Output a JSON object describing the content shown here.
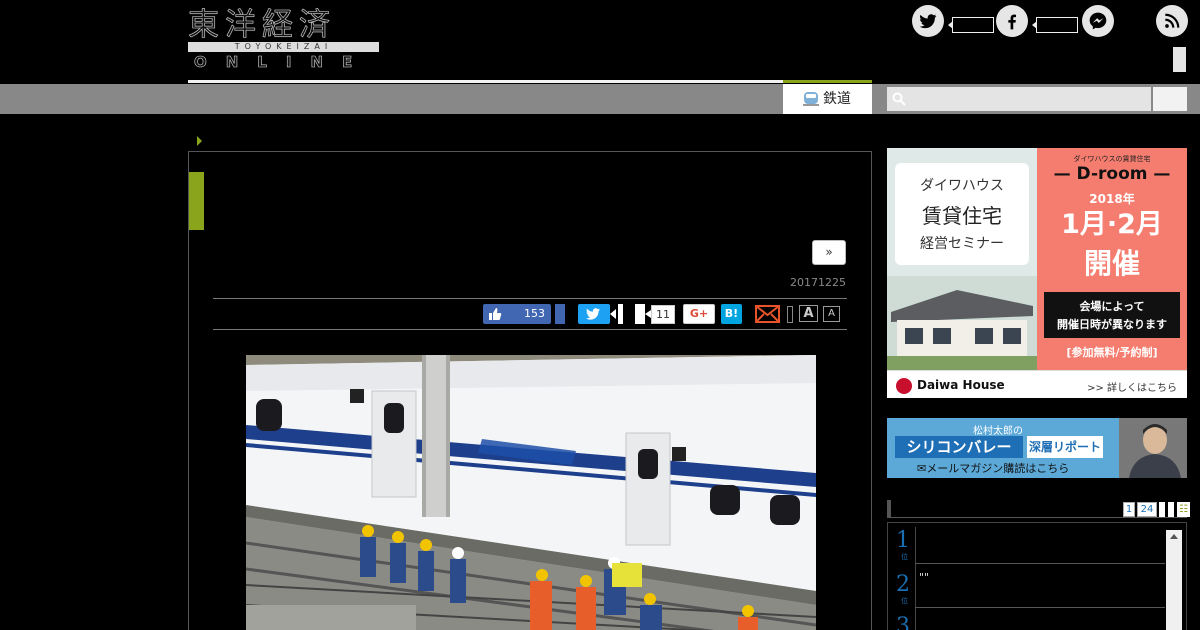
{
  "logo": {
    "kanji": "東洋経済",
    "romaji": "TOYOKEIZAI",
    "online": "ONLINE"
  },
  "nav": {
    "tab_label": "鉄道",
    "search_placeholder": ""
  },
  "article": {
    "next_label": "»",
    "date": "20171225",
    "share": {
      "like_count": "153",
      "comment_count": "11",
      "gplus_label": "G+",
      "hatena_label": "B!",
      "font_large": "A",
      "font_small": "A"
    }
  },
  "ad_daiwa": {
    "left_line1": "ダイワハウス",
    "left_line2": "賃貸住宅",
    "left_line3": "経営セミナー",
    "right_small": "ダイワハウスの賃貸住宅",
    "right_brand": "— D-room —",
    "right_year": "2018年",
    "right_months": "1月·2月",
    "right_held": "開催",
    "right_box_line1": "会場によって",
    "right_box_line2": "開催日時が異なります",
    "right_free": "[参加無料/予約制]",
    "footer_logo": "Daiwa House",
    "footer_more": ">> 詳しくはこちら"
  },
  "ad_silicon": {
    "small": "松村太郎の",
    "main": "シリコンバレー",
    "report": "深層リポート",
    "mail": "✉メールマガジン購読はこちら"
  },
  "ranking": {
    "pages": [
      "1",
      "24"
    ],
    "items": [
      {
        "num": "1",
        "suffix": "位",
        "title": ""
      },
      {
        "num": "2",
        "suffix": "位",
        "title": "\"\""
      },
      {
        "num": "3",
        "suffix": "位",
        "title": ""
      }
    ]
  },
  "colors": {
    "accent_green": "#8aa51c",
    "facebook_blue": "#4267b2",
    "twitter_blue": "#1da1f2",
    "hatena_blue": "#00a4de",
    "mail_orange": "#e8542a"
  }
}
